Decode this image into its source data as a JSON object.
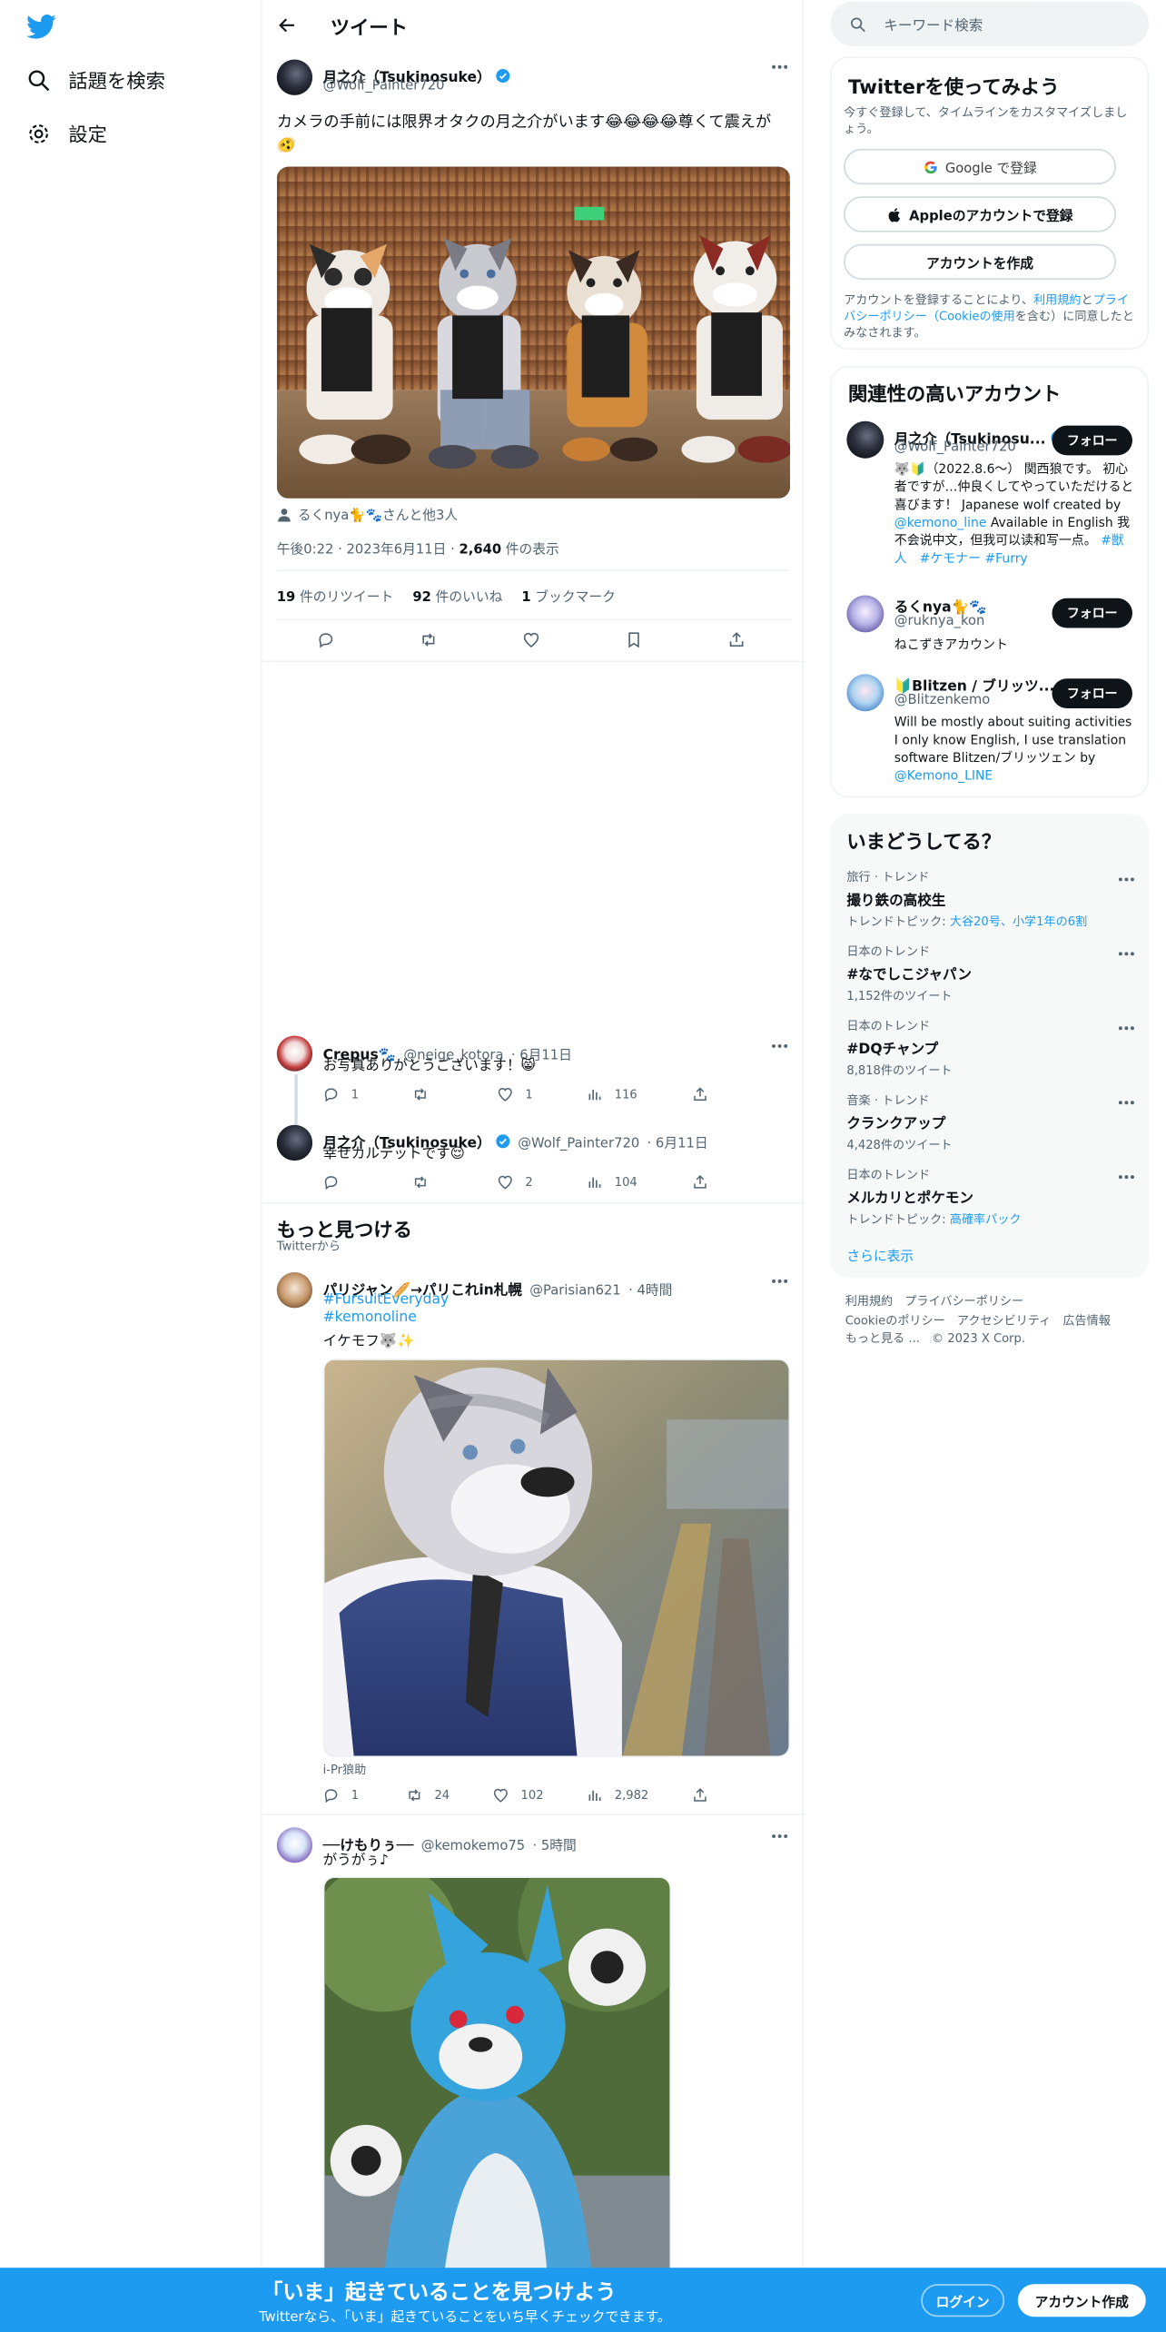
{
  "sidebar": {
    "explore": "話題を検索",
    "settings": "設定"
  },
  "header": {
    "title": "ツイート"
  },
  "tweet": {
    "name": "月之介（Tsukinosuke）",
    "handle": "@Wolf_Painter720",
    "text": "カメラの手前には限界オタクの月之介がいます😂😂😂😂尊くて震えが🫨",
    "tagged": "るくnya🐈🐾さんと他3人",
    "meta_time": "午後0:22 · 2023年6月11日 · ",
    "views": "2,640",
    "views_label": " 件の表示",
    "retweets": "19",
    "retweets_label": " 件のリツイート",
    "likes": "92",
    "likes_label": " 件のいいね",
    "bookmarks": "1",
    "bookmarks_label": " ブックマーク"
  },
  "replies": [
    {
      "name": "Crepus🐾",
      "handle": "@neige_kotora",
      "date": "· 6月11日",
      "text": "お写真ありがとうございます！😸",
      "replies": "1",
      "retweets": "",
      "likes": "1",
      "views": "116"
    },
    {
      "name": "月之介（Tsukinosuke）",
      "handle": "@Wolf_Painter720",
      "date": "· 6月11日",
      "text": "幸せカルテットです😌",
      "replies": "",
      "retweets": "",
      "likes": "2",
      "views": "104"
    }
  ],
  "discover": {
    "title": "もっと見つける",
    "subtitle": "Twitterから"
  },
  "feed": [
    {
      "name": "パリジャン🥖→パリこれin札幌",
      "handle": "@Parisian621",
      "time": "· 4時間",
      "tag1": "#FursuitEveryday",
      "tag2": "#kemonoline",
      "text": "イケモフ🐺✨",
      "caption": "i-Pr狼助",
      "replies": "1",
      "retweets": "24",
      "likes": "102",
      "views": "2,982"
    },
    {
      "name": "──けもりぅ──",
      "handle": "@kemokemo75",
      "time": "· 5時間",
      "text": "がうがぅ♪"
    }
  ],
  "search": {
    "placeholder": "キーワード検索"
  },
  "signup": {
    "title": "Twitterを使ってみよう",
    "sub": "今すぐ登録して、タイムラインをカスタマイズしましょう。",
    "google": "Google で登録",
    "apple": "Appleのアカウントで登録",
    "create": "アカウントを作成",
    "legal1": "アカウントを登録することにより、",
    "legal_terms": "利用規約",
    "legal2": "と",
    "legal_privacy": "プライバシーポリシー",
    "legal3": "（",
    "legal_cookie": "Cookieの使用",
    "legal4": "を含む）に同意したとみなされます。"
  },
  "related": {
    "title": "関連性の高いアカウント",
    "follow": "フォロー",
    "accounts": [
      {
        "name": "月之介（Tsukinosu...",
        "handle": "@Wolf_Painter720",
        "bio": "🐺🔰（2022.8.6〜） 関西狼です。 初心者ですが…仲良くしてやっていただけると喜びます！ Japanese wolf created by ",
        "bio_link": "@kemono_line",
        "bio2": " Available in English 我不会说中文，但我可以读和写一点。 ",
        "bio_tags": "#獣人　#ケモナー #Furry"
      },
      {
        "name": "るくnya🐈🐾",
        "handle": "@ruknya_kon",
        "bio": "ねこずきアカウント"
      },
      {
        "name": "🔰Blitzen / ブリッツ...",
        "handle": "@Blitzenkemo",
        "bio": "Will be mostly about suiting activities I only know English, I use translation software Blitzen/ブリッツェン by ",
        "bio_link": "@Kemono_LINE"
      }
    ]
  },
  "trends": {
    "title": "いまどうしてる？",
    "items": [
      {
        "meta": "旅行 · トレンド",
        "title": "撮り鉄の高校生",
        "ctx_label": "トレンドトピック: ",
        "ctx": "大谷20号、小学1年の6割"
      },
      {
        "meta": "日本のトレンド",
        "title": "#なでしこジャパン",
        "ctx_label": "1,152件のツイート",
        "ctx": ""
      },
      {
        "meta": "日本のトレンド",
        "title": "#DQチャンプ",
        "ctx_label": "8,818件のツイート",
        "ctx": ""
      },
      {
        "meta": "音楽 · トレンド",
        "title": "クランクアップ",
        "ctx_label": "4,428件のツイート",
        "ctx": ""
      },
      {
        "meta": "日本のトレンド",
        "title": "メルカリとポケモン",
        "ctx_label": "トレンドトピック: ",
        "ctx": "高確率パック"
      }
    ],
    "show_more": "さらに表示"
  },
  "footer": {
    "terms": "利用規約",
    "privacy": "プライバシーポリシー",
    "cookie": "Cookieのポリシー",
    "access": "アクセシビリティ",
    "ads": "広告情報",
    "more": "もっと見る ...",
    "copy": "© 2023 X Corp."
  },
  "banner": {
    "title": "「いま」起きていることを見つけよう",
    "sub": "Twitterなら、「いま」起きていることをいち早くチェックできます。",
    "login": "ログイン",
    "signup": "アカウント作成"
  },
  "colors": {
    "accent": "#1d9bf0",
    "text": "#0f1419",
    "muted": "#536471"
  }
}
